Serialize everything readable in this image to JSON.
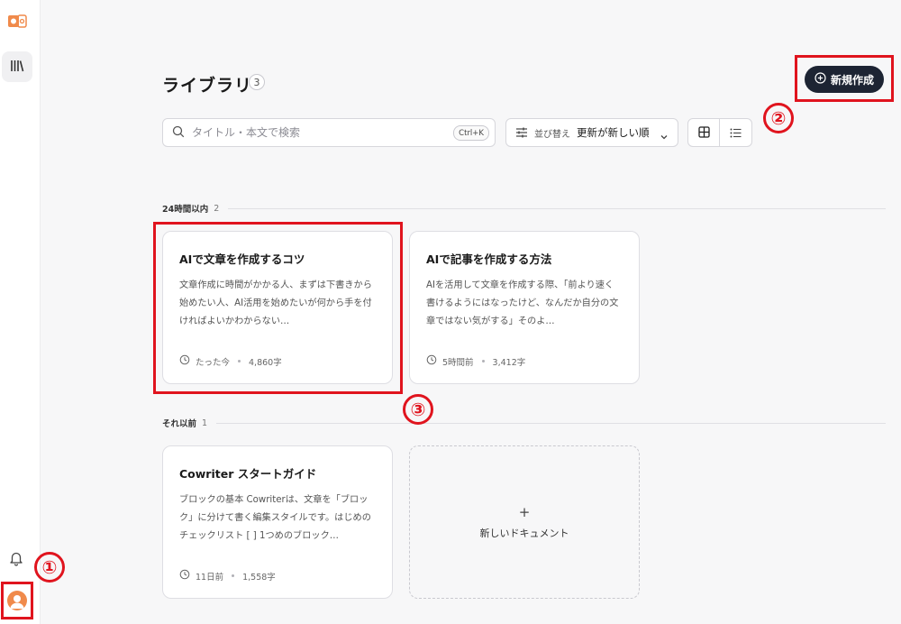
{
  "sidebar": {
    "logo": "cowriter-logo-icon",
    "library_icon": "library-icon",
    "bell_icon": "bell-icon",
    "avatar_icon": "user-avatar-icon"
  },
  "header": {
    "title": "ライブラリ",
    "count": "3",
    "new_button_label": "新規作成"
  },
  "search": {
    "placeholder": "タイトル・本文で検索",
    "shortcut": "Ctrl+K"
  },
  "sort": {
    "label": "並び替え",
    "value": "更新が新しい順"
  },
  "sections": [
    {
      "title": "24時間以内",
      "count": "2",
      "cards": [
        {
          "title": "AIで文章を作成するコツ",
          "excerpt": "文章作成に時間がかかる人、まずは下書きから始めたい人、AI活用を始めたいが何から手を付ければよいかわからない…",
          "time": "たった今",
          "chars": "4,860字"
        },
        {
          "title": "AIで記事を作成する方法",
          "excerpt": "AIを活用して文章を作成する際、「前より速く書けるようにはなったけど、なんだか自分の文章ではない気がする」そのよ…",
          "time": "5時間前",
          "chars": "3,412字"
        }
      ]
    },
    {
      "title": "それ以前",
      "count": "1",
      "cards": [
        {
          "title": "Cowriter スタートガイド",
          "excerpt": "ブロックの基本 Cowriterは、文章を「ブロック」に分けて書く編集スタイルです。はじめのチェックリスト [ ] 1つめのブロック…",
          "time": "11日前",
          "chars": "1,558字"
        }
      ]
    }
  ],
  "new_document": {
    "plus": "+",
    "label": "新しいドキュメント"
  },
  "annotations": {
    "step1": "①",
    "step2": "②",
    "step3": "③",
    "color": "#e0141e"
  },
  "colors": {
    "primary_button": "#1d2433",
    "highlight": "#e0141e",
    "avatar": "#f08a4b",
    "background": "#f7f7f8"
  }
}
